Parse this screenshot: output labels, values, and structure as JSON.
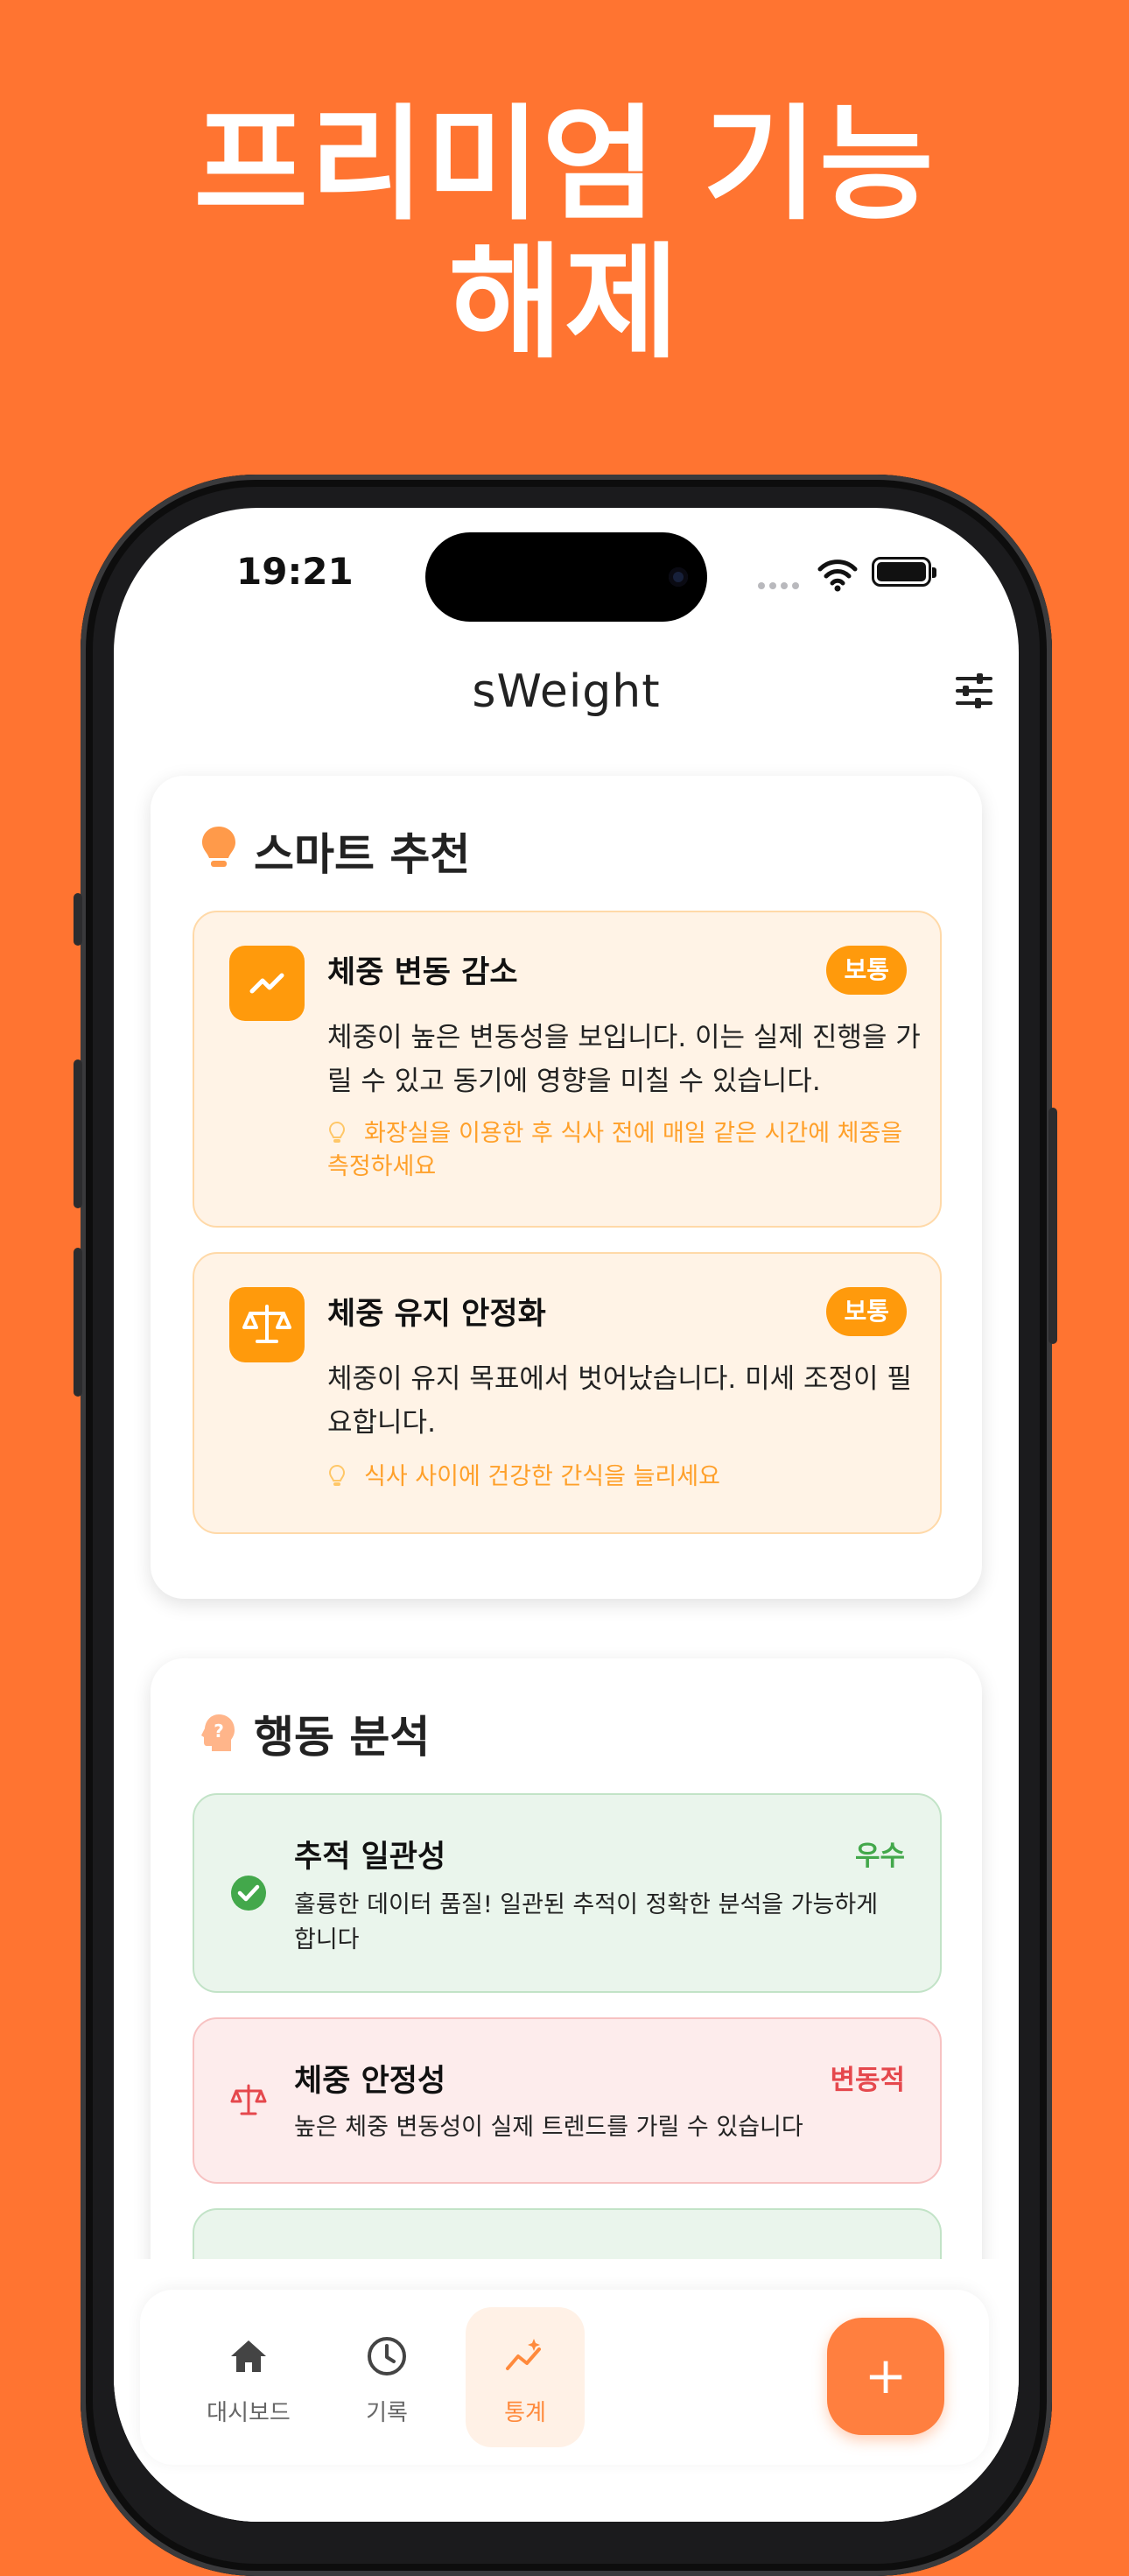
{
  "headline": {
    "line1": "프리미엄 기능",
    "line2": "해제"
  },
  "status_bar": {
    "time": "19:21"
  },
  "app": {
    "title": "sWeight"
  },
  "smart": {
    "title": "스마트 추천",
    "items": [
      {
        "title": "체중 변동 감소",
        "badge": "보통",
        "icon": "trend-icon",
        "desc": "체중이 높은 변동성을 보입니다. 이는 실제 진행을 가릴 수 있고 동기에 영향을 미칠 수 있습니다.",
        "tip": "화장실을 이용한 후 식사 전에 매일 같은 시간에 체중을 측정하세요"
      },
      {
        "title": "체중 유지 안정화",
        "badge": "보통",
        "icon": "scale-icon",
        "desc": "체중이 유지 목표에서 벗어났습니다. 미세 조정이 필요합니다.",
        "tip": "식사 사이에 건강한 간식을 늘리세요"
      }
    ]
  },
  "behavior": {
    "title": "행동 분석",
    "items": [
      {
        "title": "추적 일관성",
        "status": "우수",
        "desc": "훌륭한 데이터 품질! 일관된 추적이 정확한 분석을 가능하게 합니다",
        "icon": "check-circle-icon",
        "tone": "good"
      },
      {
        "title": "체중 안정성",
        "status": "변동적",
        "desc": "높은 체중 변동성이 실제 트렌드를 가릴 수 있습니다",
        "icon": "scale-icon",
        "tone": "bad"
      }
    ]
  },
  "nav": {
    "items": [
      {
        "label": "대시보드",
        "icon": "home-icon",
        "active": false
      },
      {
        "label": "기록",
        "icon": "clock-icon",
        "active": false
      },
      {
        "label": "통계",
        "icon": "chart-icon",
        "active": true
      }
    ],
    "fab": "+"
  },
  "colors": {
    "background": "#FF7431",
    "accent": "#FF9A0C",
    "good": "#43A84B",
    "bad": "#E5484D"
  }
}
